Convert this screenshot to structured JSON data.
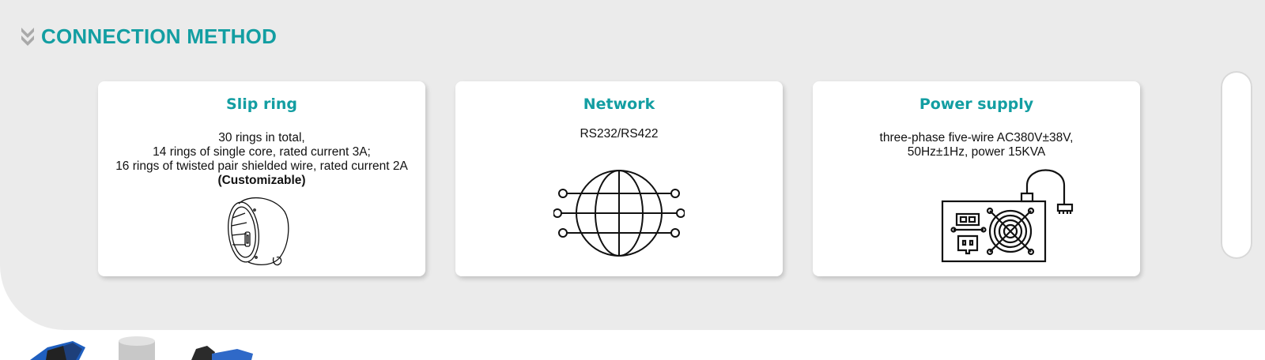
{
  "section": {
    "title": "CONNECTION METHOD",
    "icon": "double-chevron-down-icon"
  },
  "cards": [
    {
      "title": "Slip ring",
      "lines": [
        "30 rings in total,",
        "14 rings of single core, rated current 3A;",
        "16 rings of twisted pair shielded wire, rated current 2A"
      ],
      "emphasis": "(Customizable)",
      "icon": "slip-ring-icon"
    },
    {
      "title": "Network",
      "lines": [
        "RS232/RS422"
      ],
      "icon": "globe-network-icon"
    },
    {
      "title": "Power supply",
      "lines": [
        "three-phase five-wire AC380V±38V,",
        "50Hz±1Hz, power 15KVA"
      ],
      "icon": "power-supply-icon"
    }
  ],
  "colors": {
    "accent": "#139ea2",
    "panel_background": "#ebebeb",
    "card_background": "#ffffff",
    "text": "#111111"
  }
}
